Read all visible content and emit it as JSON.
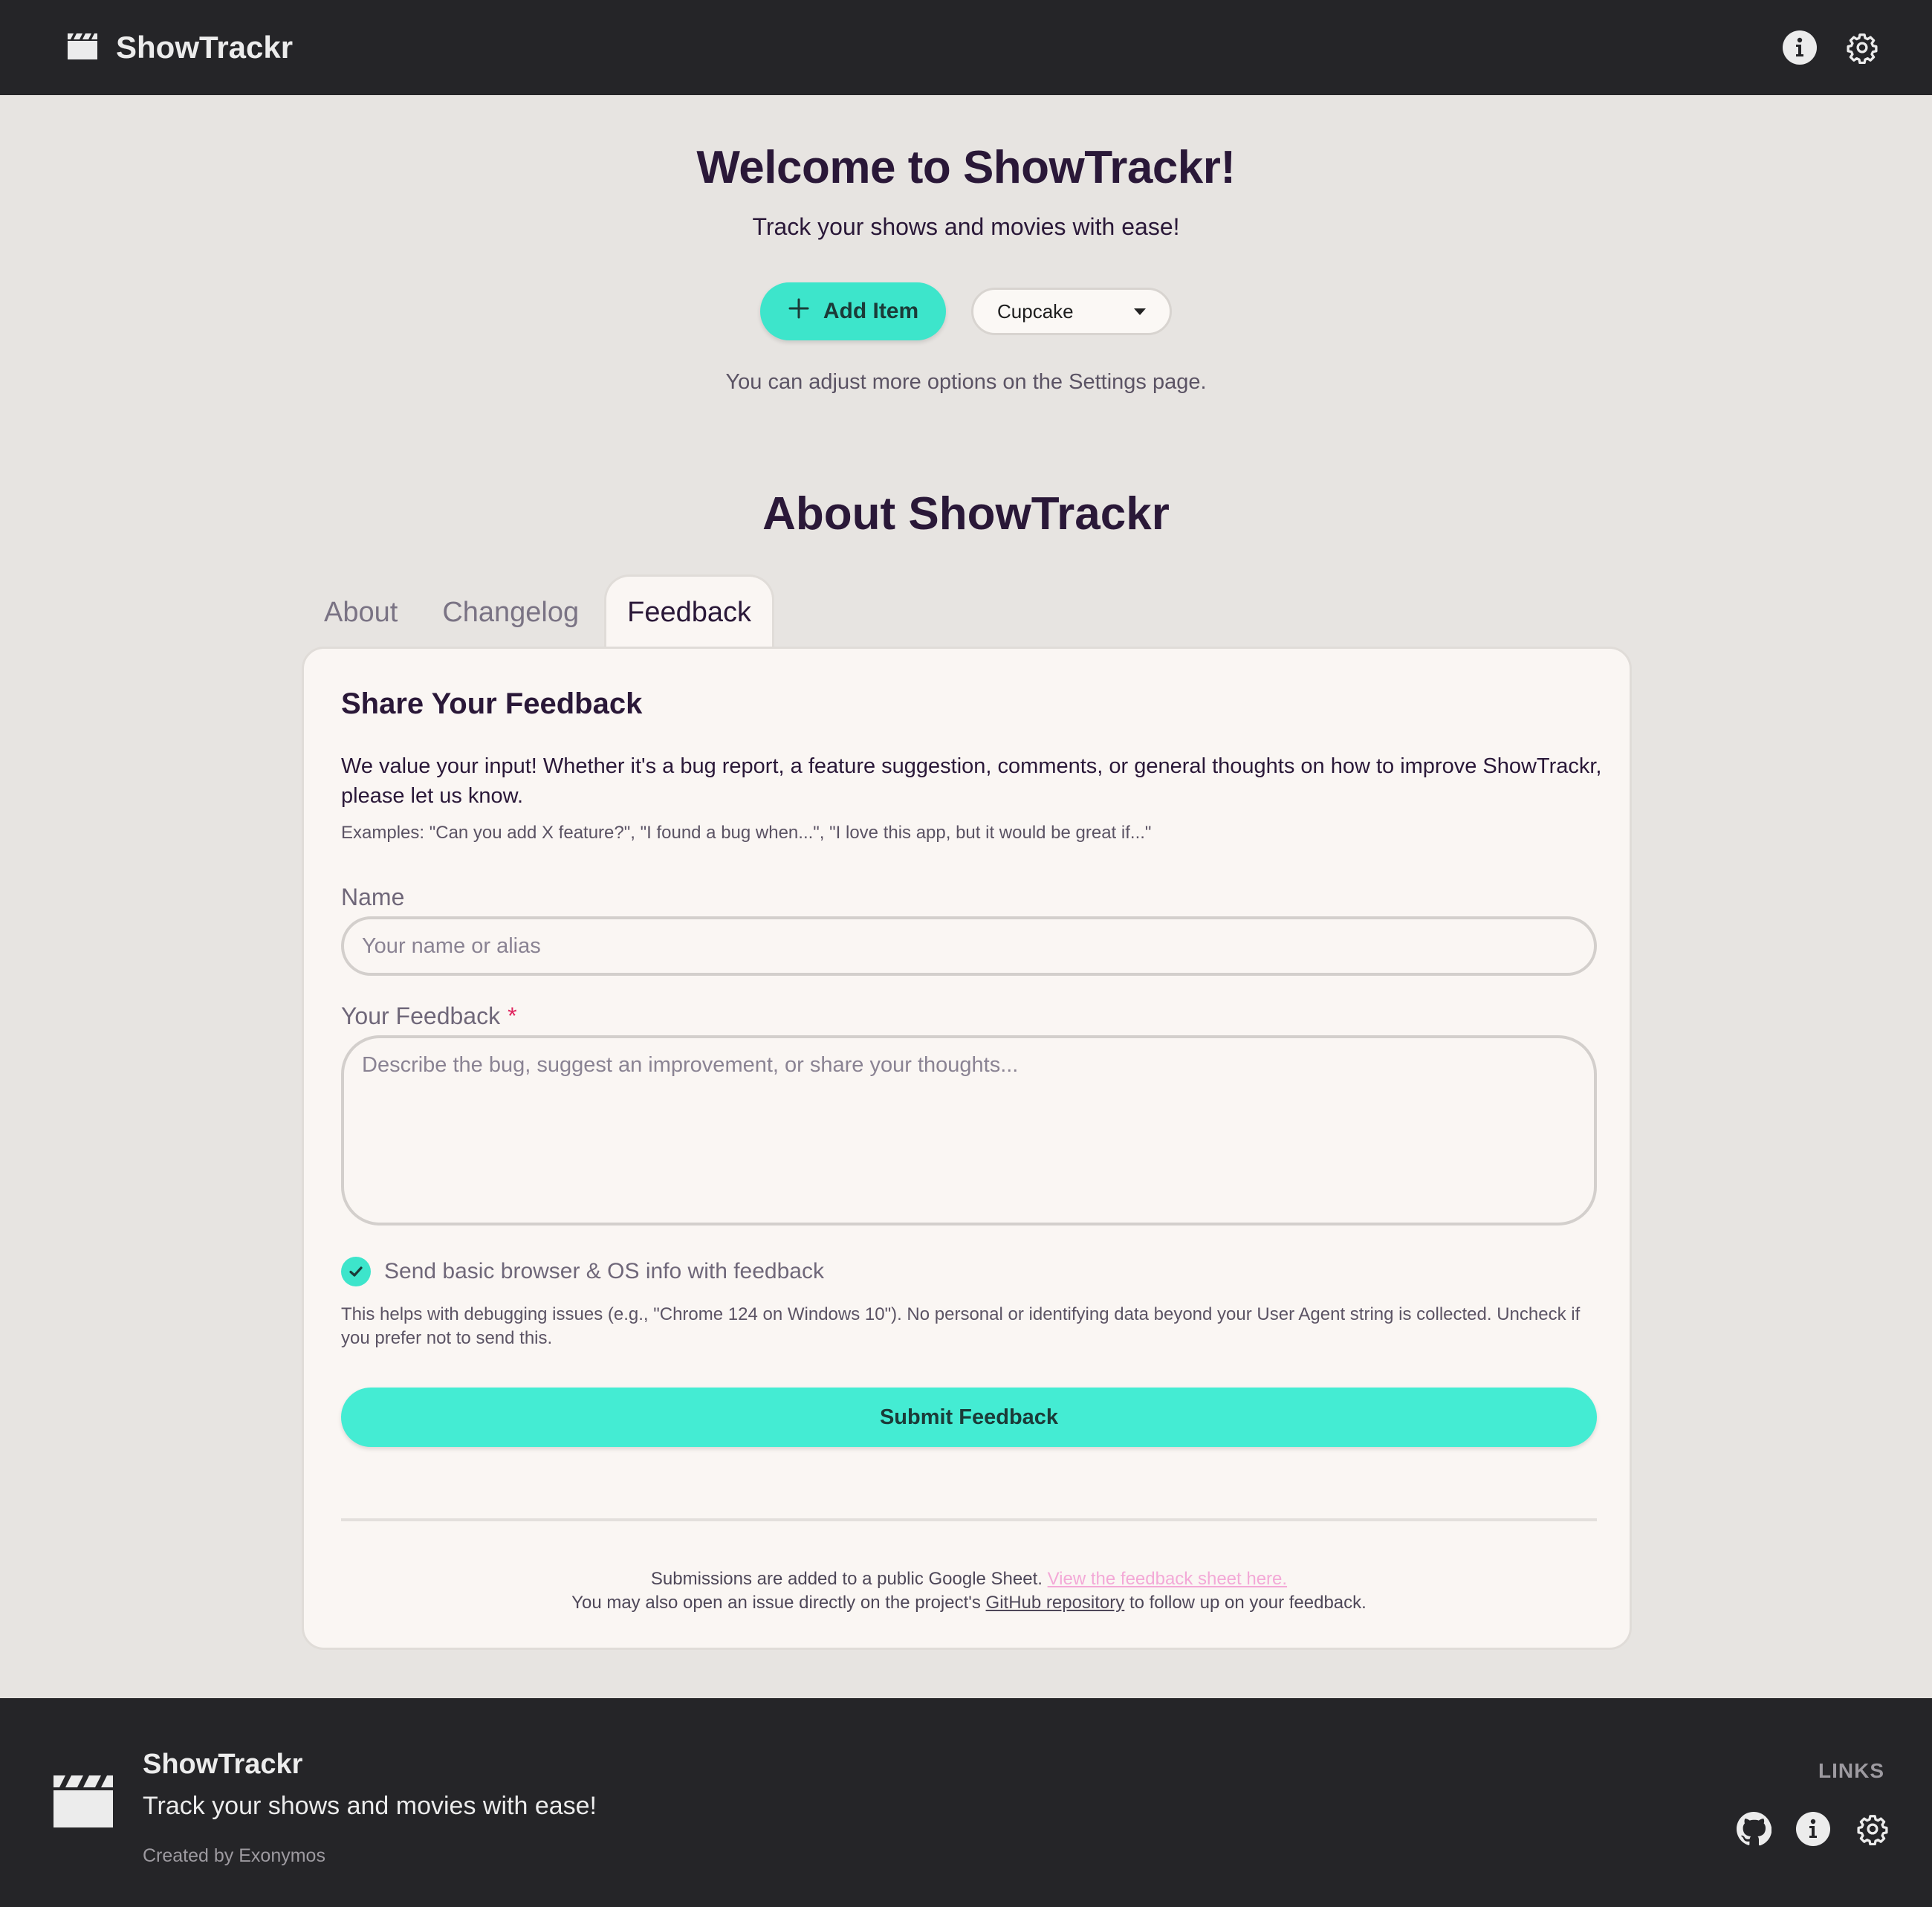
{
  "header": {
    "app_title": "ShowTrackr",
    "icons": [
      "clapperboard-icon",
      "info-icon",
      "gear-icon"
    ]
  },
  "hero": {
    "title": "Welcome to ShowTrackr!",
    "subtitle": "Track your shows and movies with ease!",
    "add_button_label": "Add Item",
    "theme_select_value": "Cupcake",
    "hint": "You can adjust more options on the Settings page."
  },
  "about": {
    "title": "About ShowTrackr",
    "tabs": [
      {
        "label": "About",
        "active": false
      },
      {
        "label": "Changelog",
        "active": false
      },
      {
        "label": "Feedback",
        "active": true
      }
    ]
  },
  "feedback": {
    "heading": "Share Your Feedback",
    "intro": "We value your input! Whether it's a bug report, a feature suggestion, comments, or general thoughts on how to improve ShowTrackr, please let us know.",
    "examples": "Examples: \"Can you add X feature?\", \"I found a bug when...\", \"I love this app, but it would be great if...\"",
    "name_label": "Name",
    "name_value": "",
    "name_placeholder": "Your name or alias",
    "feedback_label": "Your Feedback",
    "required_mark": "*",
    "feedback_value": "",
    "feedback_placeholder": "Describe the bug, suggest an improvement, or share your thoughts...",
    "checkbox_checked": true,
    "checkbox_label": "Send basic browser & OS info with feedback",
    "checkbox_note": "This helps with debugging issues (e.g., \"Chrome 124 on Windows 10\"). No personal or identifying data beyond your User Agent string is collected. Uncheck if you prefer not to send this.",
    "submit_label": "Submit Feedback",
    "footnote_line1": "Submissions are added to a public Google Sheet.",
    "sheet_link": "View the feedback sheet here.",
    "footnote_line2_pre": "You may also open an issue directly on the project's",
    "github_link": "GitHub repository",
    "footnote_line2_post": "to follow up on your feedback."
  },
  "footer": {
    "title": "ShowTrackr",
    "subtitle": "Track your shows and movies with ease!",
    "credit": "Created by Exonymos",
    "links_title": "LINKS",
    "icons": [
      "github-icon",
      "info-icon",
      "gear-icon"
    ]
  },
  "colors": {
    "accent": "#3de5cb",
    "header_bg": "#252528",
    "page_bg": "#e7e4e1",
    "card_bg": "#faf6f3",
    "text": "#2a1838",
    "link_pink": "#f3a9d7",
    "required": "#e0245e"
  }
}
